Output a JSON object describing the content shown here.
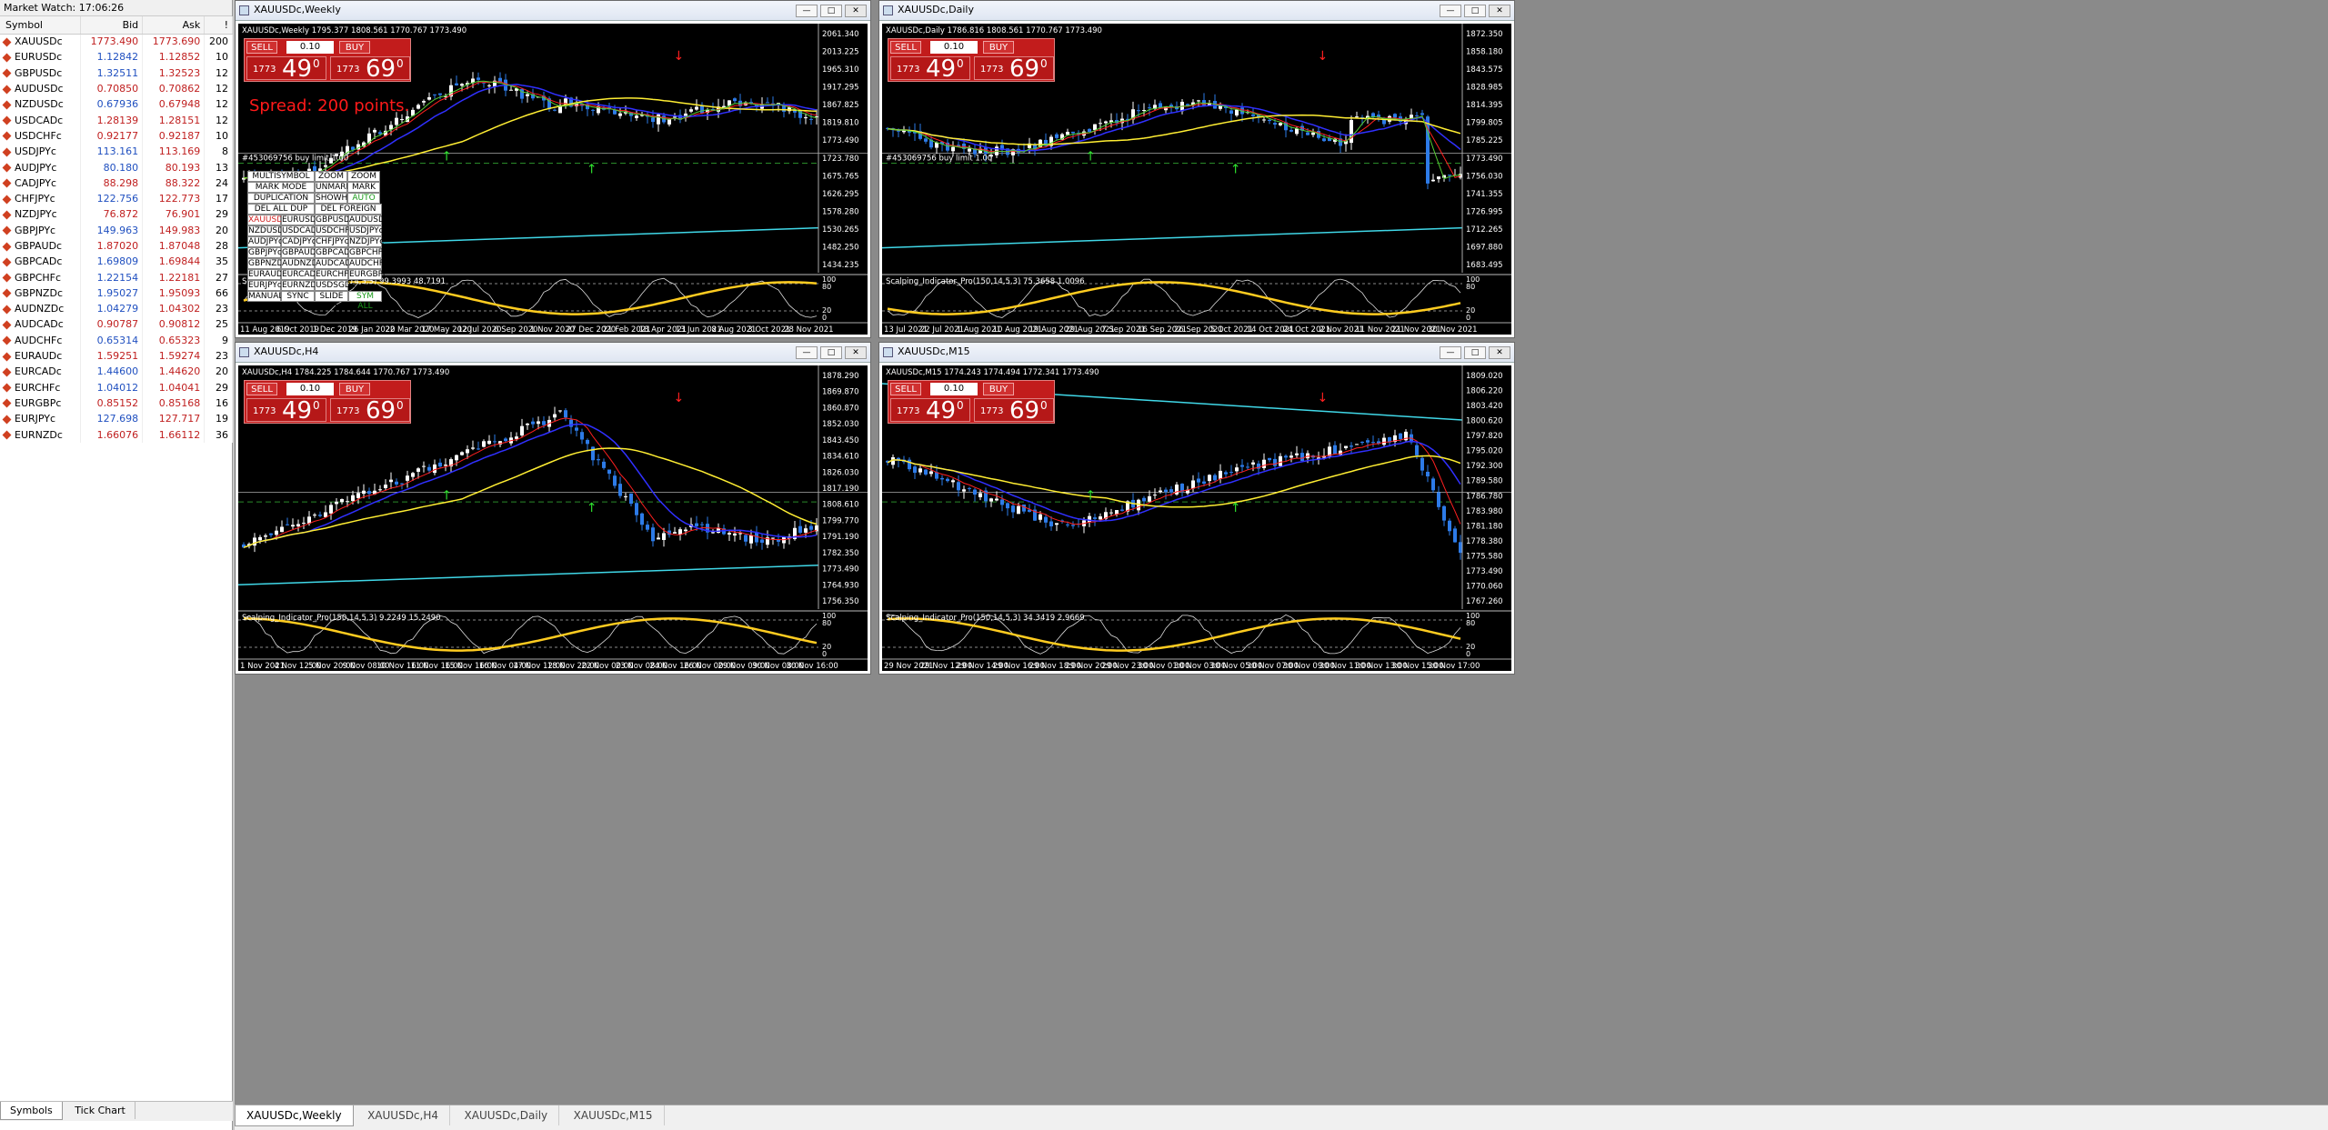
{
  "market_watch": {
    "title": "Market Watch: 17:06:26",
    "columns": [
      "Symbol",
      "Bid",
      "Ask",
      "!"
    ],
    "rows": [
      {
        "symbol": "XAUUSDc",
        "bid": "1773.490",
        "ask": "1773.690",
        "spread": "200",
        "up": true
      },
      {
        "symbol": "EURUSDc",
        "bid": "1.12842",
        "ask": "1.12852",
        "spread": "10",
        "up": false
      },
      {
        "symbol": "GBPUSDc",
        "bid": "1.32511",
        "ask": "1.32523",
        "spread": "12",
        "up": false
      },
      {
        "symbol": "AUDUSDc",
        "bid": "0.70850",
        "ask": "0.70862",
        "spread": "12",
        "up": true
      },
      {
        "symbol": "NZDUSDc",
        "bid": "0.67936",
        "ask": "0.67948",
        "spread": "12",
        "up": false
      },
      {
        "symbol": "USDCADc",
        "bid": "1.28139",
        "ask": "1.28151",
        "spread": "12",
        "up": true
      },
      {
        "symbol": "USDCHFc",
        "bid": "0.92177",
        "ask": "0.92187",
        "spread": "10",
        "up": true
      },
      {
        "symbol": "USDJPYc",
        "bid": "113.161",
        "ask": "113.169",
        "spread": "8",
        "up": false
      },
      {
        "symbol": "AUDJPYc",
        "bid": "80.180",
        "ask": "80.193",
        "spread": "13",
        "up": false
      },
      {
        "symbol": "CADJPYc",
        "bid": "88.298",
        "ask": "88.322",
        "spread": "24",
        "up": true
      },
      {
        "symbol": "CHFJPYc",
        "bid": "122.756",
        "ask": "122.773",
        "spread": "17",
        "up": false
      },
      {
        "symbol": "NZDJPYc",
        "bid": "76.872",
        "ask": "76.901",
        "spread": "29",
        "up": true
      },
      {
        "symbol": "GBPJPYc",
        "bid": "149.963",
        "ask": "149.983",
        "spread": "20",
        "up": false
      },
      {
        "symbol": "GBPAUDc",
        "bid": "1.87020",
        "ask": "1.87048",
        "spread": "28",
        "up": true
      },
      {
        "symbol": "GBPCADc",
        "bid": "1.69809",
        "ask": "1.69844",
        "spread": "35",
        "up": false
      },
      {
        "symbol": "GBPCHFc",
        "bid": "1.22154",
        "ask": "1.22181",
        "spread": "27",
        "up": false
      },
      {
        "symbol": "GBPNZDc",
        "bid": "1.95027",
        "ask": "1.95093",
        "spread": "66",
        "up": false
      },
      {
        "symbol": "AUDNZDc",
        "bid": "1.04279",
        "ask": "1.04302",
        "spread": "23",
        "up": false
      },
      {
        "symbol": "AUDCADc",
        "bid": "0.90787",
        "ask": "0.90812",
        "spread": "25",
        "up": true
      },
      {
        "symbol": "AUDCHFc",
        "bid": "0.65314",
        "ask": "0.65323",
        "spread": "9",
        "up": false
      },
      {
        "symbol": "EURAUDc",
        "bid": "1.59251",
        "ask": "1.59274",
        "spread": "23",
        "up": true
      },
      {
        "symbol": "EURCADc",
        "bid": "1.44600",
        "ask": "1.44620",
        "spread": "20",
        "up": false
      },
      {
        "symbol": "EURCHFc",
        "bid": "1.04012",
        "ask": "1.04041",
        "spread": "29",
        "up": false
      },
      {
        "symbol": "EURGBPc",
        "bid": "0.85152",
        "ask": "0.85168",
        "spread": "16",
        "up": true
      },
      {
        "symbol": "EURJPYc",
        "bid": "127.698",
        "ask": "127.717",
        "spread": "19",
        "up": false
      },
      {
        "symbol": "EURNZDc",
        "bid": "1.66076",
        "ask": "1.66112",
        "spread": "36",
        "up": true
      }
    ],
    "tabs": [
      "Symbols",
      "Tick Chart"
    ]
  },
  "bottom_tabs": [
    "XAUUSDc,Weekly",
    "XAUUSDc,H4",
    "XAUUSDc,Daily",
    "XAUUSDc,M15"
  ],
  "trade_panel": {
    "sell": "SELL",
    "buy": "BUY",
    "lot": "0.10",
    "sell_small": "1773",
    "sell_big": "49",
    "sell_sup": "0",
    "buy_small": "1773",
    "buy_big": "69",
    "buy_sup": "0"
  },
  "windows": {
    "weekly": {
      "title": "XAUUSDc,Weekly",
      "ohlc": "XAUUSDc,Weekly  1795.377 1808.561 1770.767 1773.490",
      "spread_text": "Spread: 200 points.",
      "order_text": "#453069756 buy limit 1.00",
      "indicator": "Scalping_Indicator_Pro(150,14,5,3) 99.3993 48.7191",
      "price_labels": [
        "2061.340",
        "2013.225",
        "1965.310",
        "1917.295",
        "1867.825",
        "1819.810",
        "1773.490",
        "1723.780",
        "1675.765",
        "1626.295",
        "1578.280",
        "1530.265",
        "1482.250",
        "1434.235"
      ],
      "ind_labels": [
        "100",
        "80",
        "20",
        "0"
      ],
      "time_labels": [
        "11 Aug 2019",
        "6 Oct 2019",
        "1 Dec 2019",
        "26 Jan 2020",
        "22 Mar 2020",
        "17 May 2020",
        "12 Jul 2020",
        "6 Sep 2020",
        "1 Nov 2020",
        "27 Dec 2020",
        "21 Feb 2021",
        "18 Apr 2021",
        "13 Jun 2021",
        "8 Aug 2021",
        "3 Oct 2021",
        "28 Nov 2021"
      ]
    },
    "daily": {
      "title": "XAUUSDc,Daily",
      "ohlc": "XAUUSDc,Daily  1786.816 1808.561 1770.767 1773.490",
      "order_text": "#453069756 buy limit 1.00",
      "indicator": "Scalping_Indicator_Pro(150,14,5,3) 75.3658 1.0096",
      "price_labels": [
        "1872.350",
        "1858.180",
        "1843.575",
        "1828.985",
        "1814.395",
        "1799.805",
        "1785.225",
        "1773.490",
        "1756.030",
        "1741.355",
        "1726.995",
        "1712.265",
        "1697.880",
        "1683.495"
      ],
      "ind_labels": [
        "100",
        "80",
        "20",
        "0"
      ],
      "time_labels": [
        "13 Jul 2021",
        "22 Jul 2021",
        "1 Aug 2021",
        "10 Aug 2021",
        "19 Aug 2021",
        "29 Aug 2021",
        "7 Sep 2021",
        "16 Sep 2021",
        "26 Sep 2021",
        "5 Oct 2021",
        "14 Oct 2021",
        "24 Oct 2021",
        "2 Nov 2021",
        "11 Nov 2021",
        "21 Nov 2021",
        "30 Nov 2021"
      ]
    },
    "h4": {
      "title": "XAUUSDc,H4",
      "ohlc": "XAUUSDc,H4  1784.225 1784.644 1770.767 1773.490",
      "indicator": "Scalping_Indicator_Pro(150,14,5,3) 9.2249 15.2490",
      "price_labels": [
        "1878.290",
        "1869.870",
        "1860.870",
        "1852.030",
        "1843.450",
        "1834.610",
        "1826.030",
        "1817.190",
        "1808.610",
        "1799.770",
        "1791.190",
        "1782.350",
        "1773.490",
        "1764.930",
        "1756.350"
      ],
      "ind_labels": [
        "100",
        "80",
        "20",
        "0"
      ],
      "time_labels": [
        "1 Nov 2021",
        "4 Nov 12:00",
        "5 Nov 20:00",
        "9 Nov 08:00",
        "10 Nov 16:00",
        "11 Nov 16:00",
        "15 Nov 16:00",
        "16 Nov 04:00",
        "17 Nov 12:00",
        "18 Nov 20:00",
        "22 Nov 00:00",
        "23 Nov 08:00",
        "24 Nov 16:00",
        "26 Nov 00:00",
        "29 Nov 09:00",
        "30 Nov 08:00",
        "30 Nov 16:00"
      ]
    },
    "m15": {
      "title": "XAUUSDc,M15",
      "ohlc": "XAUUSDc,M15  1774.243 1774.494 1772.341 1773.490",
      "indicator": "Scalping_Indicator_Pro(150,14,5,3) 34.3419 2.9669",
      "price_labels": [
        "1809.020",
        "1806.220",
        "1803.420",
        "1800.620",
        "1797.820",
        "1795.020",
        "1792.300",
        "1789.580",
        "1786.780",
        "1783.980",
        "1781.180",
        "1778.380",
        "1775.580",
        "1773.490",
        "1770.060",
        "1767.260"
      ],
      "ind_labels": [
        "100",
        "80",
        "20",
        "0"
      ],
      "time_labels": [
        "29 Nov 2021",
        "29 Nov 12:00",
        "29 Nov 14:00",
        "29 Nov 16:00",
        "29 Nov 18:00",
        "29 Nov 20:00",
        "29 Nov 23:00",
        "30 Nov 01:00",
        "30 Nov 03:00",
        "30 Nov 05:00",
        "30 Nov 07:00",
        "30 Nov 09:00",
        "30 Nov 11:00",
        "30 Nov 13:00",
        "30 Nov 15:00",
        "30 Nov 17:00"
      ]
    }
  },
  "multisymbol_box": {
    "rows": [
      [
        "MULTISYMBOL OFF",
        "ZOOM -",
        "ZOOM +"
      ],
      [
        "MARK MODE SEL",
        "UNMARK",
        "MARK"
      ],
      [
        "DUPLICATION OFF",
        "SHOWHIDE",
        "AUTO SH+"
      ],
      [
        "DEL ALL DUP OBJ",
        "DEL FOREIGN OBJ"
      ],
      [
        "XAUUSDc",
        "EURUSDc",
        "GBPUSDc",
        "AUDUSDc"
      ],
      [
        "NZDUSDc",
        "USDCADc",
        "USDCHFc",
        "USDJPYc"
      ],
      [
        "AUDJPYc",
        "CADJPYc",
        "CHFJPYc",
        "NZDJPYc"
      ],
      [
        "GBPJPYc",
        "GBPAUDc",
        "GBPCADc",
        "GBPCHFc"
      ],
      [
        "GBPNZDc",
        "AUDNZDc",
        "AUDCADc",
        "AUDCHFc"
      ],
      [
        "EURAUDc",
        "EURCADc",
        "EURCHFc",
        "EURGBPc"
      ],
      [
        "EURJPYc",
        "EURNZDc",
        "USDSGDc"
      ],
      [
        "MANUAL",
        "SYNC",
        "SLIDE OFF",
        "SYM ALL"
      ]
    ]
  },
  "colors": {
    "bull": "#ffffff",
    "bear": "#2d7be8",
    "ma_red": "#ff2020",
    "ma_blue": "#3030ff",
    "ma_yellow": "#ffee33",
    "ma_cyan": "#40d8e8",
    "ma_green": "#55cc33",
    "cloud": "#c8a070",
    "ind_yellow": "#ffcc20"
  }
}
